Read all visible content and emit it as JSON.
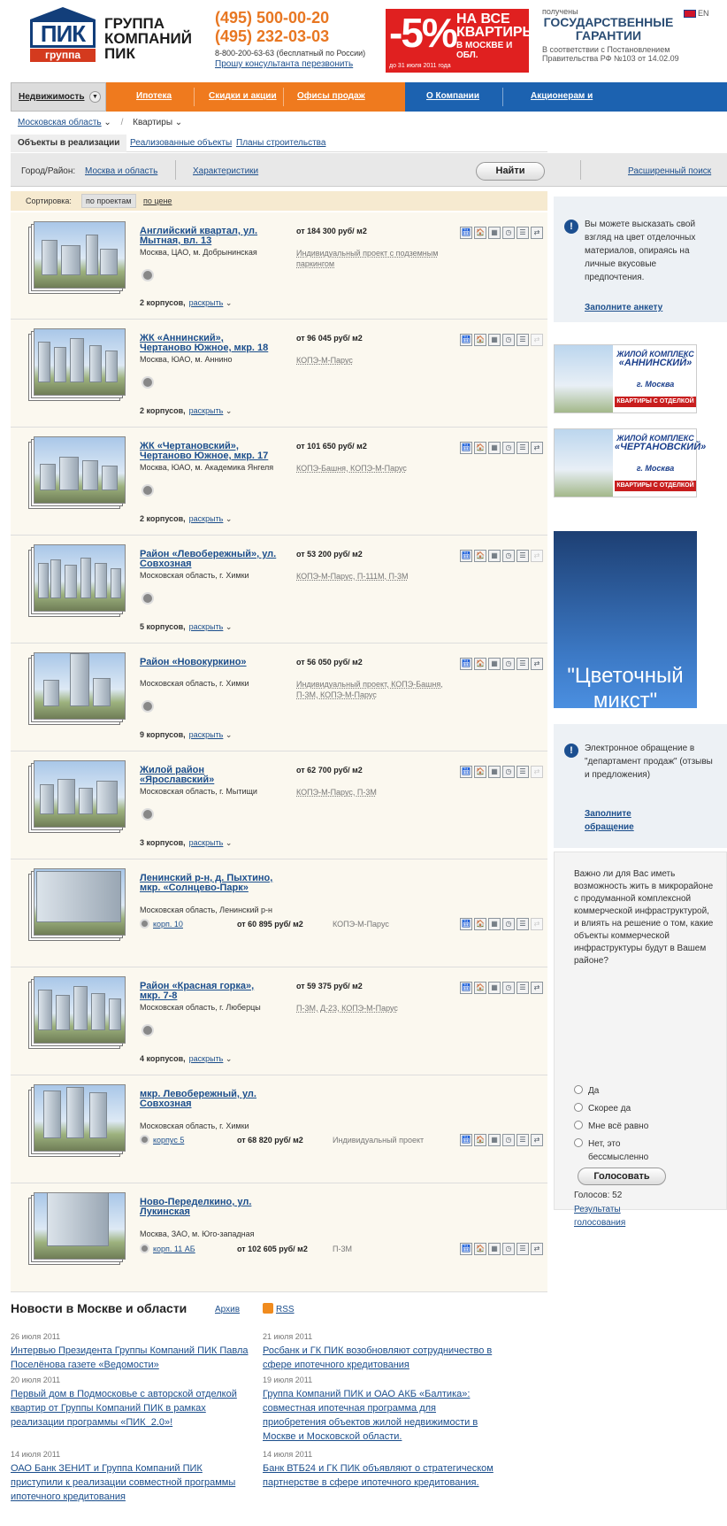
{
  "header": {
    "logo_text": "ПИК",
    "logo_sub": "группа",
    "brand": "ГРУППА КОМПАНИЙ ПИК",
    "phone1": "(495) 500-00-20",
    "phone2": "(495) 232-03-03",
    "free_phone": "8-800-200-63-63 (бесплатный по России)",
    "callback": "Прошу консультанта перезвонить",
    "promo_big": "-5%",
    "promo_line1": "НА ВСЕ КВАРТИРЫ",
    "promo_line2": "В МОСКВЕ И ОБЛ.",
    "promo_date": "до 31 июля 2011 года",
    "guar_small": "получены",
    "guar_big": "ГОСУДАРСТВЕННЫЕ ГАРАНТИИ",
    "guar_note": "В соответствии с Постановлением Правительства РФ №103 от 14.02.09",
    "lang": "EN"
  },
  "nav": {
    "realty": "Недвижимость",
    "items": [
      "Ипотека",
      "Скидки и акции",
      "Офисы продаж",
      "О Компании",
      "Акционерам и"
    ]
  },
  "breadcrumbs": [
    "Московская область",
    "Квартиры"
  ],
  "subtabs": [
    "Объекты в реализации",
    "Реализованные объекты",
    "Планы строительства"
  ],
  "filter": {
    "city_label": "Город/Район:",
    "city_value": "Москва и область",
    "features": "Характеристики",
    "find": "Найти",
    "advanced": "Расширенный поиск"
  },
  "sort": {
    "label": "Сортировка:",
    "active": "по проектам",
    "other": "по цене"
  },
  "projects": [
    {
      "title": "Английский квартал, ул. Мытная, вл. 13",
      "price": "от 184 300 руб/ м2",
      "location": "Москва, ЦАО, м. Добрынинская",
      "type": "Индивидуальный проект с подземным паркингом",
      "count": "2 корпусов,",
      "expand": "раскрыть"
    },
    {
      "title": "ЖК «Аннинский», Чертаново Южное, мкр. 18",
      "price": "от 96 045 руб/ м2",
      "location": "Москва, ЮАО, м. Аннино",
      "type": "КОПЭ-М-Парус",
      "count": "2 корпусов,",
      "expand": "раскрыть"
    },
    {
      "title": "ЖК «Чертановский», Чертаново Южное, мкр. 17",
      "price": "от 101 650 руб/ м2",
      "location": "Москва, ЮАО, м. Академика Янгеля",
      "type": "КОПЭ-Башня, КОПЭ-М-Парус",
      "count": "2 корпусов,",
      "expand": "раскрыть"
    },
    {
      "title": "Район «Левобережный», ул. Совхозная",
      "price": "от 53 200 руб/ м2",
      "location": "Московская область, г. Химки",
      "type": "КОПЭ-М-Парус, П-111М, П-3М",
      "count": "5 корпусов,",
      "expand": "раскрыть"
    },
    {
      "title": "Район «Новокуркино»",
      "price": "от 56 050 руб/ м2",
      "location": "Московская область, г. Химки",
      "type": "Индивидуальный проект, КОПЭ-Башня, П-3М, КОПЭ-М-Парус",
      "count": "9 корпусов,",
      "expand": "раскрыть"
    },
    {
      "title": "Жилой район «Ярославский»",
      "price": "от 62 700 руб/ м2",
      "location": "Московская область, г. Мытищи",
      "type": "КОПЭ-М-Парус, П-3М",
      "count": "3 корпусов,",
      "expand": "раскрыть"
    },
    {
      "title": "Ленинский р-н, д. Пыхтино, мкр. «Солнцево-Парк»",
      "price": "от 60 895 руб/ м2",
      "location": "Московская область, Ленинский р-н",
      "type": "КОПЭ-М-Парус",
      "link": "корп. 10"
    },
    {
      "title": "Район «Красная горка», мкр. 7-8",
      "price": "от 59 375 руб/ м2",
      "location": "Московская область, г. Люберцы",
      "type": "П-3М, Д-23, КОПЭ-М-Парус",
      "count": "4 корпусов,",
      "expand": "раскрыть"
    },
    {
      "title": "мкр. Левобережный, ул. Совхозная",
      "price": "от 68 820 руб/ м2",
      "location": "Московская область, г. Химки",
      "type": "Индивидуальный проект",
      "link": "корпус 5"
    },
    {
      "title": "Ново-Переделкино, ул. Лукинская",
      "price": "от 102 605 руб/ м2",
      "location": "Москва, ЗАО, м. Юго-западная",
      "type": "П-3М",
      "link": "корп. 11 АБ"
    }
  ],
  "right": {
    "box1_text": "Вы можете высказать свой взгляд на цвет отделочных материалов, опираясь на личные вкусовые предпочтения.",
    "box1_link": "Заполните анкету",
    "ban1_t1": "ЖИЛОЙ КОМПЛЕКС",
    "ban1_name": "«АННИНСКИЙ»",
    "ban1_city": "г. Москва",
    "ban1_cta": "КВАРТИРЫ С ОТДЕЛКОЙ",
    "ban2_t1": "ЖИЛОЙ КОМПЛЕКС",
    "ban2_name": "«ЧЕРТАНОВСКИЙ»",
    "ban2_city": "г. Москва",
    "ban2_cta": "КВАРТИРЫ С ОТДЕЛКОЙ",
    "flower": "\"Цветочный микст\"",
    "box2_text": "Электронное обращение в \"департамент продаж\" (отзывы и предложения)",
    "box2_link": "Заполните обращение",
    "poll_q": "Важно ли для Вас иметь возможность жить в микрорайоне с продуманной комплексной коммерческой инфраструктурой, и влиять на решение о том, какие объекты коммерческой инфраструктуры будут в Вашем районе?",
    "poll_opts": [
      "Да",
      "Скорее да",
      "Мне всё равно",
      "Нет, это бессмысленно"
    ],
    "vote": "Голосовать",
    "votes": "Голосов: 52",
    "results": "Результаты голосования"
  },
  "news": {
    "title": "Новости в Москве и области",
    "archive": "Архив",
    "rss": "RSS",
    "items": [
      {
        "date": "26 июля 2011",
        "text": "Интервью Президента Группы Компаний ПИК Павла Поселёнова газете «Ведомости»"
      },
      {
        "date": "21 июля 2011",
        "text": "Росбанк и ГК ПИК возобновляют сотрудничество в сфере ипотечного кредитования"
      },
      {
        "date": "20 июля 2011",
        "text": "Первый дом в Подмосковье с авторской отделкой квартир от Группы Компаний ПИК в рамках реализации программы «ПИК_2.0»!"
      },
      {
        "date": "19 июля 2011",
        "text": "Группа Компаний ПИК и ОАО АКБ «Балтика»: совместная ипотечная программа для приобретения объектов жилой недвижимости в Москве и Московской области."
      },
      {
        "date": "14 июля 2011",
        "text": "ОАО Банк ЗЕНИТ и Группа Компаний ПИК приступили к реализации совместной программы ипотечного кредитования"
      },
      {
        "date": "14 июля 2011",
        "text": "Банк ВТБ24 и ГК ПИК объявляют о стратегическом партнерстве в сфере ипотечного кредитования."
      }
    ]
  }
}
